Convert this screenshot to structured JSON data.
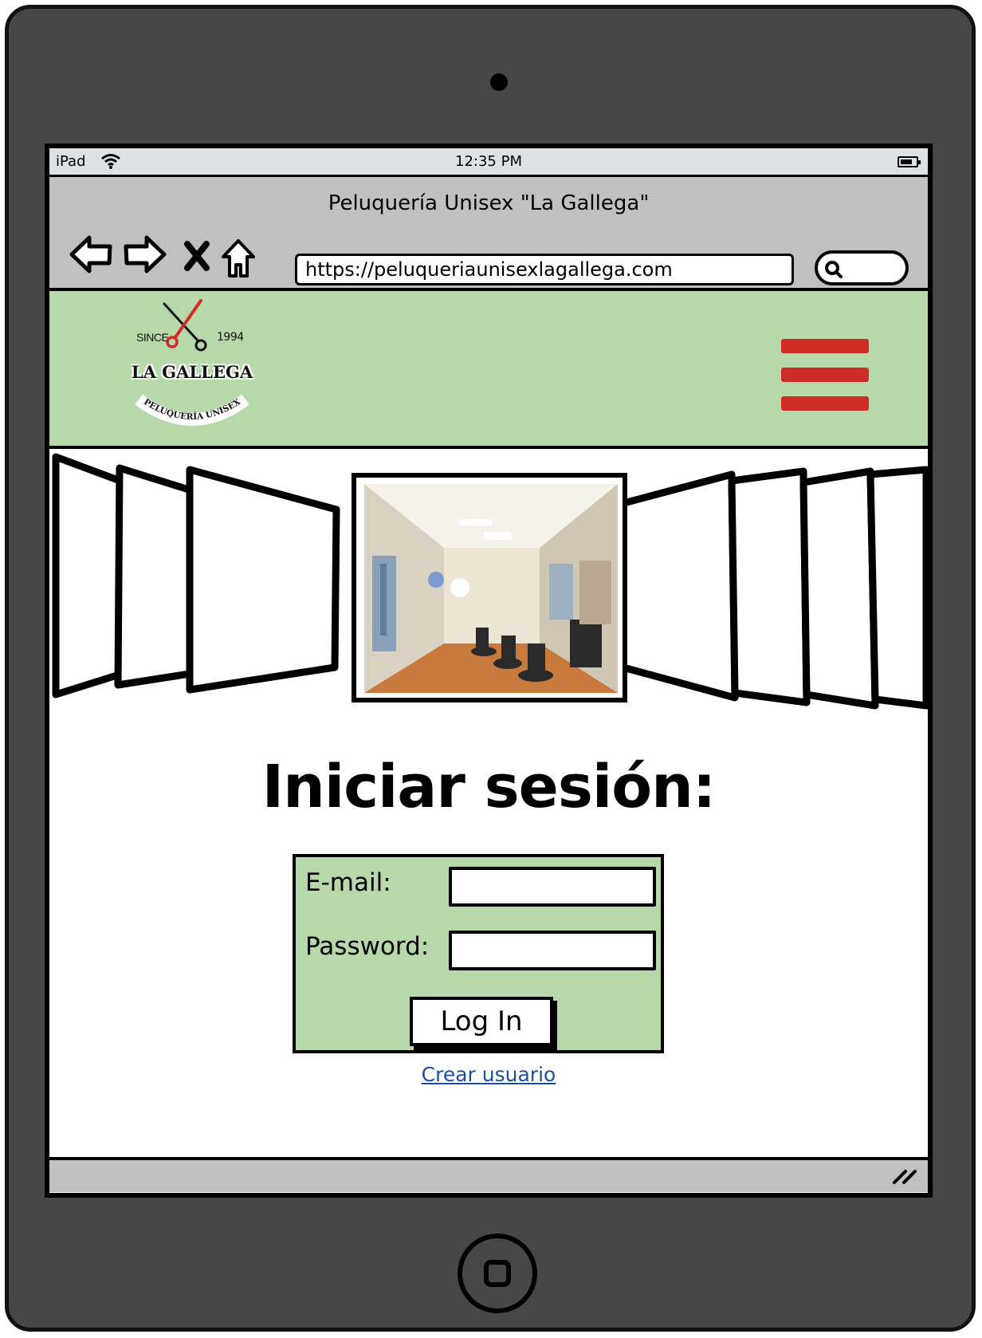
{
  "statusbar": {
    "device": "iPad",
    "time": "12:35 PM"
  },
  "browser": {
    "title": "Peluquería Unisex \"La Gallega\"",
    "url": "https://peluqueriaunisexlagallega.com",
    "icons": [
      "back-arrow-icon",
      "forward-arrow-icon",
      "close-icon",
      "home-icon",
      "search-icon"
    ]
  },
  "header": {
    "logo": {
      "since": "SINCE",
      "year": "1994",
      "brand": "LA GALLEGA",
      "tagline": "PELUQUERÍA UNISEX"
    },
    "menu_icon": "hamburger-menu-icon",
    "accent": "#cf2b27",
    "background": "#b7d8a8"
  },
  "login": {
    "title": "Iniciar sesión:",
    "email_label": "E-mail:",
    "email_value": "",
    "password_label": "Password:",
    "password_value": "",
    "button_label": "Log In",
    "create_user_link": "Crear usuario"
  },
  "colors": {
    "form_bg": "#b7d8a8",
    "link": "#1a4fa0",
    "device": "#474747",
    "bars": "#c0c0c0"
  }
}
